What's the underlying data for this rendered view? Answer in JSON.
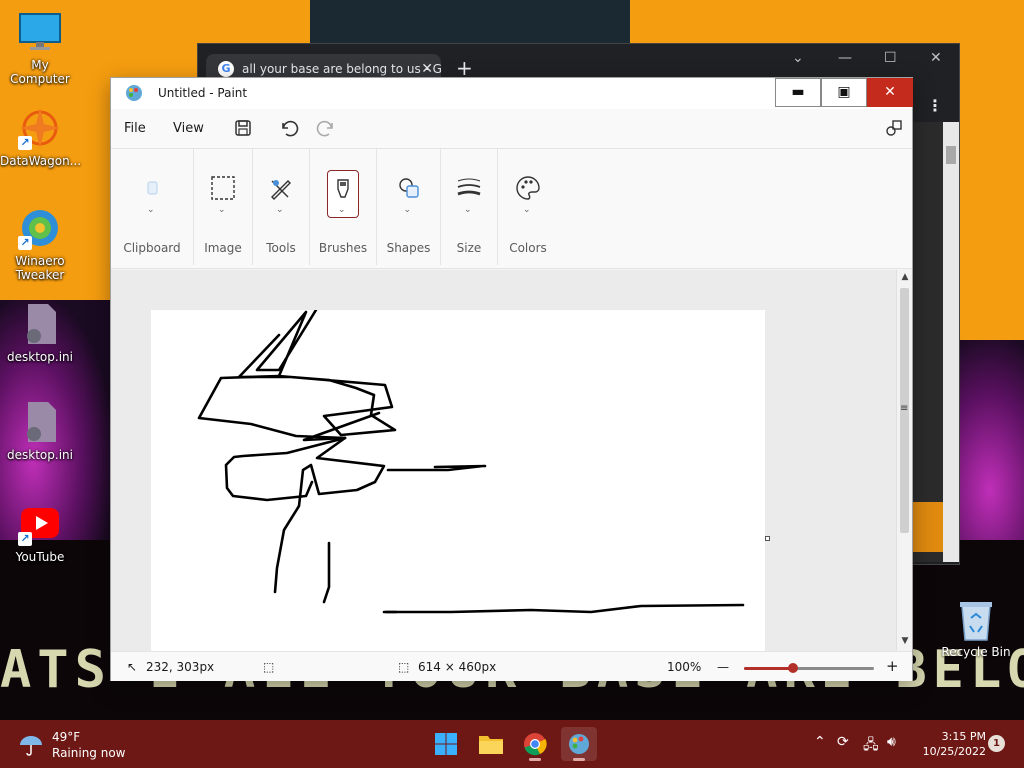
{
  "desktop": {
    "icons": [
      {
        "label": "My Computer"
      },
      {
        "label": "DataWagon..."
      },
      {
        "label": "Winaero Tweaker"
      },
      {
        "label": "desktop.ini"
      },
      {
        "label": "desktop.ini"
      },
      {
        "label": "YouTube"
      }
    ],
    "recycle_bin": "Recycle Bin",
    "marquee": "ATS I  ALL YOUR BASE ARE BELON"
  },
  "chrome": {
    "tab_title": "all your base are belong to us - G"
  },
  "paint": {
    "title": "Untitled - Paint",
    "menu": {
      "file": "File",
      "view": "View"
    },
    "ribbon": {
      "clipboard": "Clipboard",
      "image": "Image",
      "tools": "Tools",
      "brushes": "Brushes",
      "shapes": "Shapes",
      "size": "Size",
      "colors": "Colors"
    },
    "status": {
      "cursor_position": "232, 303px",
      "canvas_size": "614 × 460px",
      "zoom": "100%",
      "zoom_level": 0.38
    },
    "colors": {
      "accent": "#b3302a",
      "close": "#c42b1c"
    }
  },
  "taskbar": {
    "weather_temp": "49°F",
    "weather_desc": "Raining now",
    "time": "3:15 PM",
    "date": "10/25/2022",
    "notification_count": "1"
  }
}
